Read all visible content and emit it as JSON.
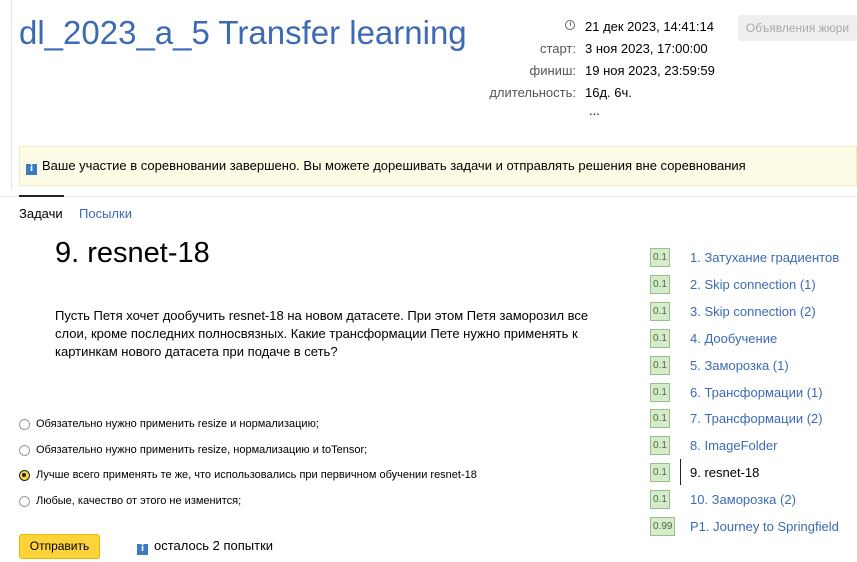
{
  "contest": {
    "title": "dl_2023_a_5 Transfer learning",
    "current_time": "21 дек 2023, 14:41:14",
    "start_label": "старт:",
    "start": "3 ноя 2023, 17:00:00",
    "finish_label": "финиш:",
    "finish": "19 ноя 2023, 23:59:59",
    "duration_label": "длительность:",
    "duration": "16д. 6ч.",
    "more": "...",
    "jury_button": "Объявления жюри"
  },
  "notice": "Ваше участие в соревновании завершено. Вы можете дорешивать задачи и отправлять решения вне соревнования",
  "tabs": [
    {
      "label": "Задачи",
      "active": true
    },
    {
      "label": "Посылки",
      "active": false
    }
  ],
  "problem": {
    "title": "9. resnet-18",
    "statement": "Пусть Петя хочет дообучить resnet-18 на новом датасете. При этом Петя заморозил все слои, кроме последних полносвязных. Какие трансформации Пете нужно применять к картинкам нового датасета при подаче в сеть?",
    "options": [
      {
        "label": "Обязательно нужно применить resize и нормализацию;",
        "checked": false
      },
      {
        "label": "Обязательно нужно применить resize, нормализацию и toTensor;",
        "checked": false
      },
      {
        "label": "Лучше всего применять те же, что использовались при первичном обучении resnet-18",
        "checked": true
      },
      {
        "label": "Любые, качество от этого не изменится;",
        "checked": false
      }
    ],
    "submit_label": "Отправить",
    "attempts_left": "осталось 2 попытки"
  },
  "sidebar": {
    "items": [
      {
        "score": "0.1",
        "label": "1. Затухание градиентов",
        "current": false
      },
      {
        "score": "0.1",
        "label": "2. Skip connection (1)",
        "current": false
      },
      {
        "score": "0.1",
        "label": "3. Skip connection (2)",
        "current": false
      },
      {
        "score": "0.1",
        "label": "4. Дообучение",
        "current": false
      },
      {
        "score": "0.1",
        "label": "5. Заморозка (1)",
        "current": false
      },
      {
        "score": "0.1",
        "label": "6. Трансформации (1)",
        "current": false
      },
      {
        "score": "0.1",
        "label": "7. Трансформации (2)",
        "current": false
      },
      {
        "score": "0.1",
        "label": "8. ImageFolder",
        "current": false
      },
      {
        "score": "0.1",
        "label": "9. resnet-18",
        "current": true
      },
      {
        "score": "0.1",
        "label": "10. Заморозка (2)",
        "current": false
      },
      {
        "score": "0.99",
        "label": "P1. Journey to Springfield",
        "current": false
      }
    ]
  }
}
